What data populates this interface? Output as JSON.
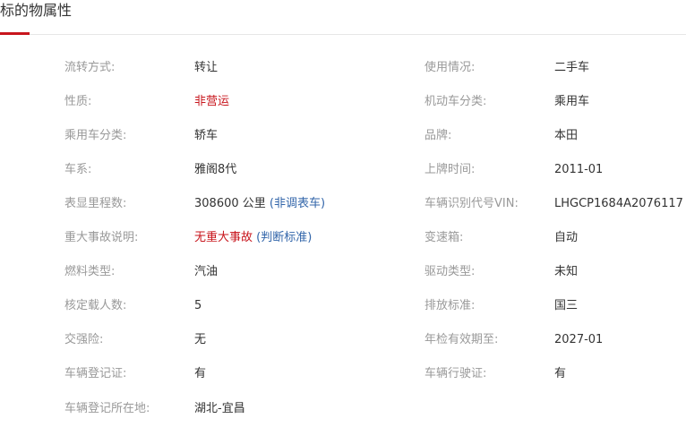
{
  "section": {
    "title": "标的物属性"
  },
  "colors": {
    "accent": "#c8161d",
    "label": "#999999",
    "value": "#333333",
    "link": "#3366aa"
  },
  "rows": [
    {
      "l1": "流转方式:",
      "v1": "转让",
      "l2": "使用情况:",
      "v2": "二手车"
    },
    {
      "l1": "性质:",
      "v1": "非营运",
      "l2": "机动车分类:",
      "v2": "乘用车"
    },
    {
      "l1": "乘用车分类:",
      "v1": "轿车",
      "l2": "品牌:",
      "v2": "本田"
    },
    {
      "l1": "车系:",
      "v1": "雅阁8代",
      "l2": "上牌时间:",
      "v2": "2011-01"
    },
    {
      "l1": "表显里程数:",
      "v1": "308600 公里",
      "v1_link": "(非调表车)",
      "l2": "车辆识别代号VIN:",
      "v2": "LHGCP1684A2076117"
    },
    {
      "l1": "重大事故说明:",
      "v1": "无重大事故",
      "v1_link": "(判断标准)",
      "l2": "变速箱:",
      "v2": "自动"
    },
    {
      "l1": "燃料类型:",
      "v1": "汽油",
      "l2": "驱动类型:",
      "v2": "未知"
    },
    {
      "l1": "核定载人数:",
      "v1": "5",
      "l2": "排放标准:",
      "v2": "国三"
    },
    {
      "l1": "交强险:",
      "v1": "无",
      "l2": "年检有效期至:",
      "v2": "2027-01"
    },
    {
      "l1": "车辆登记证:",
      "v1": "有",
      "l2": "车辆行驶证:",
      "v2": "有"
    },
    {
      "l1": "车辆登记所在地:",
      "v1": "湖北-宜昌"
    }
  ]
}
